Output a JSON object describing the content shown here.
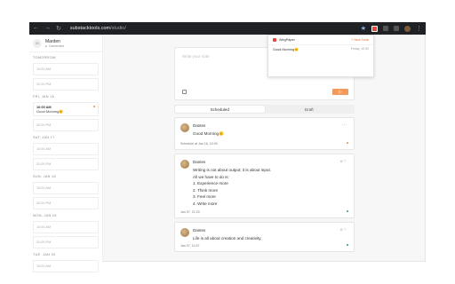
{
  "browser": {
    "url_host": "substacktools.com",
    "url_path": "/studio/"
  },
  "sidebar": {
    "profile_initial": "M",
    "profile_name": "Marden",
    "profile_status": "Connected",
    "days": [
      {
        "label": "TOMORROW",
        "slots": [
          {
            "time": "10:00 AM"
          },
          {
            "time": "02:00 PM"
          }
        ]
      },
      {
        "label": "FRI, JAN 16",
        "slots": [
          {
            "time": "10:00 AM",
            "message": "Good Morning🌞",
            "active": true
          },
          {
            "time": "02:00 PM"
          }
        ]
      },
      {
        "label": "SAT, JAN 17",
        "slots": [
          {
            "time": "10:00 AM"
          },
          {
            "time": "02:00 PM"
          }
        ]
      },
      {
        "label": "SUN, JAN 18",
        "slots": [
          {
            "time": "10:00 AM"
          },
          {
            "time": "02:00 PM"
          }
        ]
      },
      {
        "label": "MON, JAN 19",
        "slots": [
          {
            "time": "10:00 AM"
          },
          {
            "time": "02:00 PM"
          }
        ]
      },
      {
        "label": "TUE, JAN 20",
        "slots": [
          {
            "time": "10:00 AM"
          }
        ]
      }
    ]
  },
  "composer": {
    "placeholder": "Write your note"
  },
  "tabs": [
    {
      "label": "Scheduled",
      "selected": true
    },
    {
      "label": "Draft",
      "selected": false
    }
  ],
  "notes": [
    {
      "author": "Dantes",
      "lines": [
        "Good Morning🌞"
      ],
      "meta": "Schedule at Jan 16, 10:00"
    },
    {
      "author": "Dantes",
      "lines": [
        "Writing is not about output; it is about input.",
        "All we have to do is:",
        "1. Experience more",
        "2. Think more",
        "3. Feel more",
        "4. Write more"
      ],
      "meta": "Jan 07, 21:20",
      "actions": "0 ♡"
    },
    {
      "author": "Dantes",
      "lines": [
        "Life is all about creation and creativity."
      ],
      "meta": "Jan 07, 11:57",
      "actions": "0 ♡"
    }
  ],
  "popup": {
    "title": "WegPaper",
    "new_note": "+ New Note",
    "rows": [
      {
        "text": "Good Morning🌞",
        "when": "Friday, 10:00"
      }
    ]
  },
  "colors": {
    "accent": "#f29a5a",
    "chrome": "#202124"
  }
}
